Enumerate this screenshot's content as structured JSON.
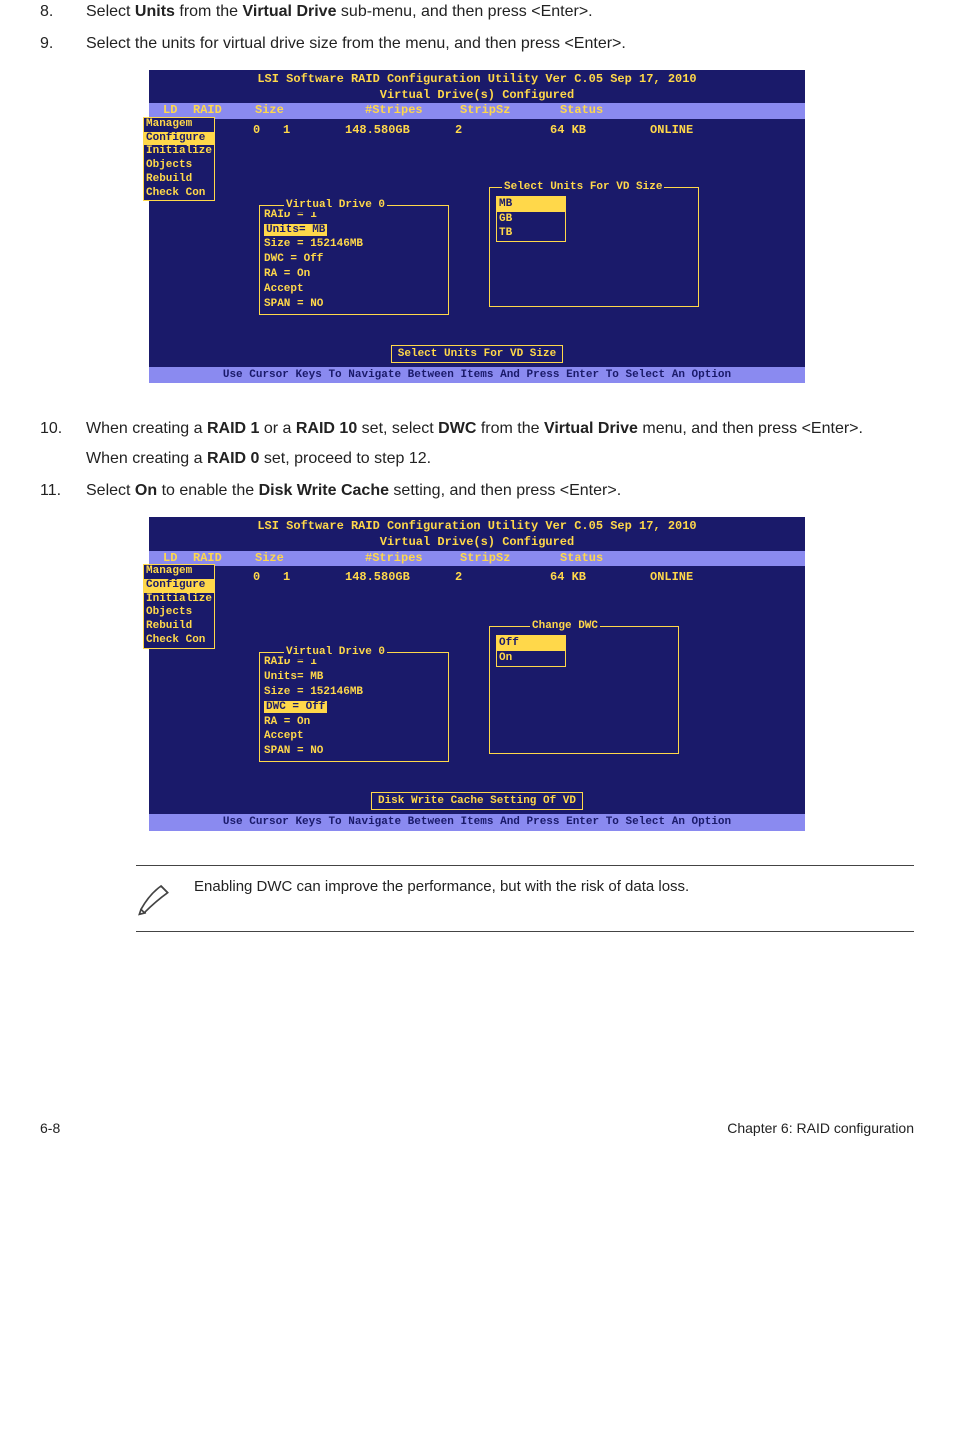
{
  "steps": {
    "s8": {
      "num": "8.",
      "text": "Select <b>Units</b> from the <b>Virtual Drive</b> sub-menu, and then press &lt;Enter&gt;."
    },
    "s9": {
      "num": "9.",
      "text": "Select the units for virtual drive size from the menu, and then press &lt;Enter&gt;."
    },
    "s10": {
      "num": "10.",
      "text1": "When creating a <b>RAID 1</b> or a <b>RAID 10</b> set, select <b>DWC</b> from the <b>Virtual Drive</b> menu, and then press &lt;Enter&gt;.",
      "text2": "When creating a <b>RAID 0</b> set, proceed to step 12."
    },
    "s11": {
      "num": "11.",
      "text": "Select <b>On</b> to enable the <b>Disk Write Cache</b> setting, and then press &lt;Enter&gt;."
    }
  },
  "shot1": {
    "title": "LSI Software RAID Configuration Utility Ver C.05 Sep 17, 2010",
    "subtitle": "Virtual Drive(s) Configured",
    "head": {
      "ld": "LD",
      "raid": "RAID",
      "size": "Size",
      "stripes": "#Stripes",
      "stripsz": "StripSz",
      "status": "Status"
    },
    "row": {
      "ld": "0",
      "raid": "1",
      "size": "148.580GB",
      "stripes": "2",
      "stripsz": "64 KB",
      "status": "ONLINE"
    },
    "side": [
      "Managem",
      "Configure",
      "Initialize",
      "Objects",
      "Rebuild",
      "Check Con"
    ],
    "vd": {
      "title": "Virtual Drive 0",
      "raid": "RAID = 1",
      "units": "Units= MB",
      "size": "Size = 152146MB",
      "dwc": "DWC  = Off",
      "ra": "RA   = On",
      "accept": "Accept",
      "span": "SPAN = NO"
    },
    "popup": {
      "title": "Select Units For VD Size",
      "opts": [
        "MB",
        "GB",
        "TB"
      ]
    },
    "hint": "Select Units For VD Size",
    "footer": "Use Cursor Keys To Navigate Between Items And Press Enter To Select An Option"
  },
  "shot2": {
    "title": "LSI Software RAID Configuration Utility Ver C.05 Sep 17, 2010",
    "subtitle": "Virtual Drive(s) Configured",
    "head": {
      "ld": "LD",
      "raid": "RAID",
      "size": "Size",
      "stripes": "#Stripes",
      "stripsz": "StripSz",
      "status": "Status"
    },
    "row": {
      "ld": "0",
      "raid": "1",
      "size": "148.580GB",
      "stripes": "2",
      "stripsz": "64 KB",
      "status": "ONLINE"
    },
    "side": [
      "Managem",
      "Configure",
      "Initialize",
      "Objects",
      "Rebuild",
      "Check Con"
    ],
    "vd": {
      "title": "Virtual Drive 0",
      "raid": "RAID = 1",
      "units": "Units= MB",
      "size": "Size = 152146MB",
      "dwc": "DWC  = Off",
      "ra": "RA   = On",
      "accept": "Accept",
      "span": "SPAN = NO"
    },
    "popup": {
      "title": "Change DWC",
      "opts": [
        "Off",
        "On"
      ]
    },
    "hint": "Disk Write Cache Setting Of VD",
    "footer": "Use Cursor Keys To Navigate Between Items And Press Enter To Select An Option"
  },
  "note": "Enabling DWC can improve the performance, but with the risk of data loss.",
  "page": {
    "left": "6-8",
    "right": "Chapter 6: RAID configuration"
  }
}
